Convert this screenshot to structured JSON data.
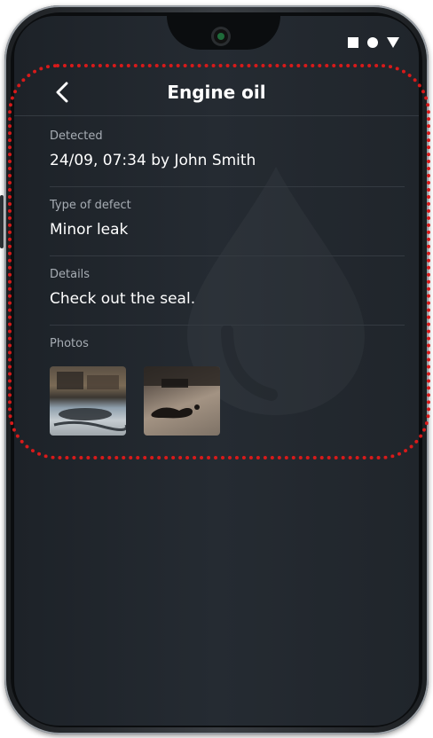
{
  "header": {
    "title": "Engine oil",
    "back_icon": "chevron-left-icon"
  },
  "status_bar": {
    "icons": [
      "square-icon",
      "circle-icon",
      "triangle-icon"
    ],
    "color": "#ffffff"
  },
  "fields": [
    {
      "label": "Detected",
      "value": "24/09, 07:34 by John Smith"
    },
    {
      "label": "Type of defect",
      "value": "Minor leak"
    },
    {
      "label": "Details",
      "value": "Check out the seal."
    }
  ],
  "photos": {
    "label": "Photos",
    "items": [
      "engine-oil-photo",
      "oil-stain-photo"
    ]
  },
  "colors": {
    "background": "#22272d",
    "divider": "#343a41",
    "label": "#a7adb4",
    "text": "#ffffff",
    "highlight_outline": "#d81a1a"
  }
}
